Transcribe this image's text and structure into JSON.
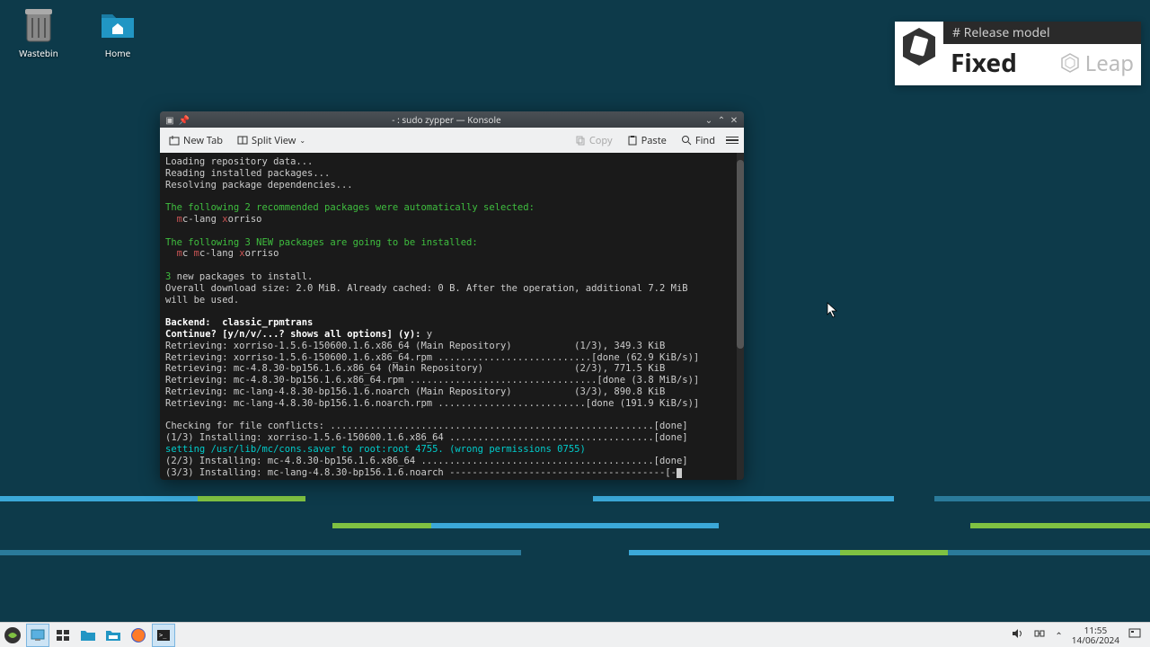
{
  "desktop": {
    "icons": [
      {
        "label": "Wastebin",
        "icon": "trash"
      },
      {
        "label": "Home",
        "icon": "folder"
      }
    ]
  },
  "release": {
    "header": "# Release model",
    "main": "Fixed",
    "brand": "Leap"
  },
  "window": {
    "title": "- : sudo zypper — Konsole",
    "toolbar": {
      "new_tab": "New Tab",
      "split_view": "Split View",
      "copy": "Copy",
      "paste": "Paste",
      "find": "Find"
    }
  },
  "terminal": {
    "lines": [
      {
        "t": "Loading repository data..."
      },
      {
        "t": "Reading installed packages..."
      },
      {
        "t": "Resolving package dependencies..."
      },
      {
        "t": ""
      },
      {
        "t": "The following 2 recommended packages were automatically selected:",
        "c": "green"
      },
      {
        "segs": [
          {
            "t": "  "
          },
          {
            "t": "m",
            "c": "red"
          },
          {
            "t": "c-lang "
          },
          {
            "t": "x",
            "c": "red"
          },
          {
            "t": "orriso"
          }
        ]
      },
      {
        "t": ""
      },
      {
        "t": "The following 3 NEW packages are going to be installed:",
        "c": "green"
      },
      {
        "segs": [
          {
            "t": "  "
          },
          {
            "t": "m",
            "c": "red"
          },
          {
            "t": "c "
          },
          {
            "t": "m",
            "c": "red"
          },
          {
            "t": "c-lang "
          },
          {
            "t": "x",
            "c": "red"
          },
          {
            "t": "orriso"
          }
        ]
      },
      {
        "t": ""
      },
      {
        "segs": [
          {
            "t": "3",
            "c": "green"
          },
          {
            "t": " new packages to install."
          }
        ]
      },
      {
        "t": "Overall download size: 2.0 MiB. Already cached: 0 B. After the operation, additional 7.2 MiB"
      },
      {
        "t": "will be used."
      },
      {
        "t": ""
      },
      {
        "t": "Backend:  classic_rpmtrans",
        "c": "bold"
      },
      {
        "segs": [
          {
            "t": "Continue? [y/n/v/...? shows all options] (y): ",
            "c": "bold"
          },
          {
            "t": "y"
          }
        ]
      },
      {
        "t": "Retrieving: xorriso-1.5.6-150600.1.6.x86_64 (Main Repository)           (1/3), 349.3 KiB"
      },
      {
        "t": "Retrieving: xorriso-1.5.6-150600.1.6.x86_64.rpm ...........................[done (62.9 KiB/s)]"
      },
      {
        "t": "Retrieving: mc-4.8.30-bp156.1.6.x86_64 (Main Repository)                (2/3), 771.5 KiB"
      },
      {
        "t": "Retrieving: mc-4.8.30-bp156.1.6.x86_64.rpm .................................[done (3.8 MiB/s)]"
      },
      {
        "t": "Retrieving: mc-lang-4.8.30-bp156.1.6.noarch (Main Repository)           (3/3), 890.8 KiB"
      },
      {
        "t": "Retrieving: mc-lang-4.8.30-bp156.1.6.noarch.rpm ..........................[done (191.9 KiB/s)]"
      },
      {
        "t": ""
      },
      {
        "t": "Checking for file conflicts: .........................................................[done]"
      },
      {
        "t": "(1/3) Installing: xorriso-1.5.6-150600.1.6.x86_64 ....................................[done]"
      },
      {
        "t": "setting /usr/lib/mc/cons.saver to root:root 4755. (wrong permissions 0755)",
        "c": "cyan"
      },
      {
        "t": "(2/3) Installing: mc-4.8.30-bp156.1.6.x86_64 .........................................[done]"
      },
      {
        "segs": [
          {
            "t": "(3/3) Installing: mc-lang-4.8.30-bp156.1.6.noarch --------------------------------------[-"
          },
          {
            "cursor": true
          }
        ]
      }
    ]
  },
  "taskbar": {
    "time": "11:55",
    "date": "14/06/2024"
  }
}
